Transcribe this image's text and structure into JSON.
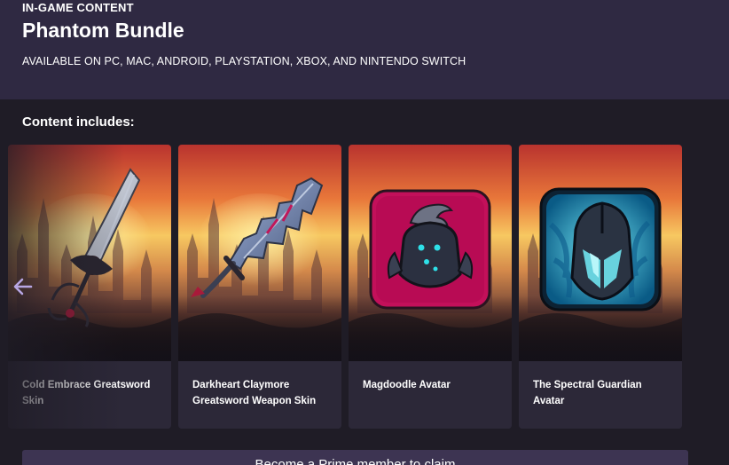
{
  "header": {
    "eyebrow": "IN-GAME CONTENT",
    "title": "Phantom Bundle",
    "platforms": "AVAILABLE ON PC, MAC, ANDROID, PLAYSTATION, XBOX, AND NINTENDO SWITCH"
  },
  "content": {
    "heading": "Content includes:",
    "items": [
      {
        "line1": "Cold Embrace Greatsword",
        "line2": "Skin",
        "icon": "greatsword-icon"
      },
      {
        "line1": "Darkheart Claymore",
        "line2": "Greatsword Weapon Skin",
        "icon": "claymore-icon"
      },
      {
        "line1": "Magdoodle Avatar",
        "line2": "",
        "icon": "avatar-icon"
      },
      {
        "line1": "The Spectral Guardian",
        "line2": "Avatar",
        "icon": "avatar-icon"
      }
    ]
  },
  "carousel": {
    "prev_icon": "arrow-left-icon"
  },
  "cta": {
    "label": "Become a Prime member to claim"
  },
  "colors": {
    "header_bg": "#2f2942",
    "page_bg": "#1f1c26",
    "card_bg": "#2c2838",
    "cta_bg": "#3d3452",
    "arrow": "#b7a6e3",
    "avatar_pink": "#c3105a",
    "avatar_teal": "#1aa6c9"
  }
}
